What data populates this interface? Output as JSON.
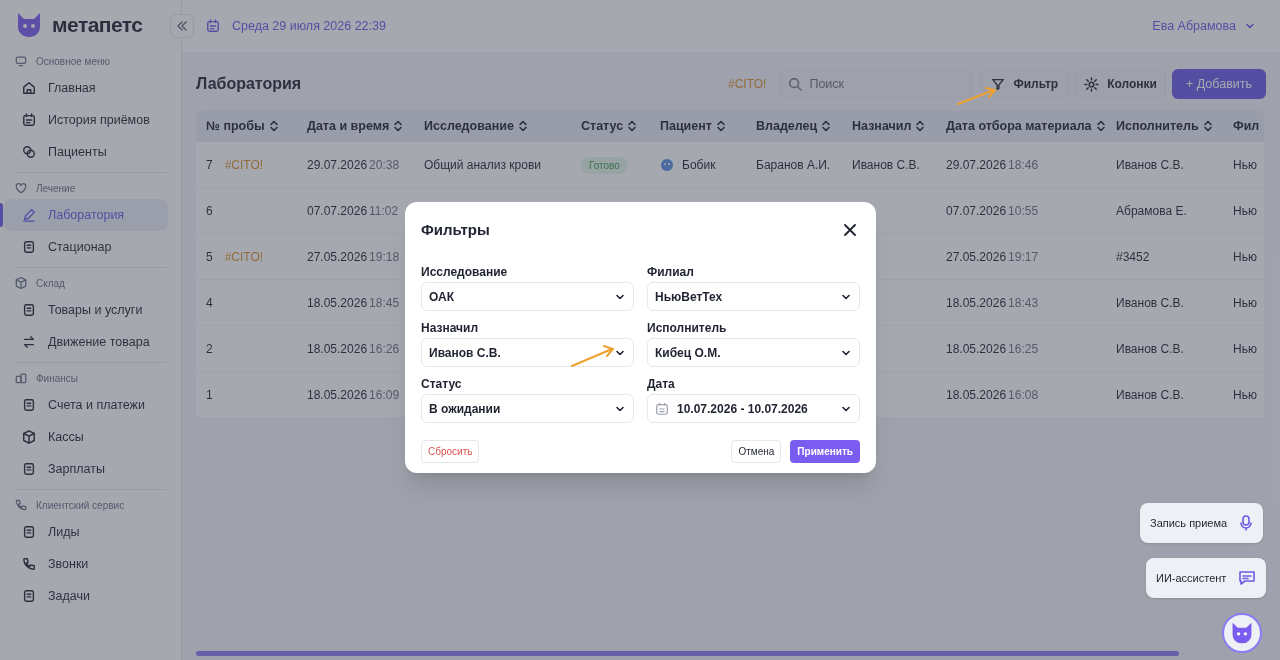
{
  "logo": {
    "text": "метапетс"
  },
  "header": {
    "date": "Среда 29 июля 2026 22:39",
    "user": "Ева Абрамова"
  },
  "sidebar": {
    "sections": [
      {
        "title": "Основное меню",
        "items": [
          {
            "label": "Главная",
            "selected": false
          },
          {
            "label": "История приёмов",
            "selected": false
          },
          {
            "label": "Пациенты",
            "selected": false
          }
        ]
      },
      {
        "title": "Лечение",
        "items": [
          {
            "label": "Лаборатория",
            "selected": true
          },
          {
            "label": "Стационар",
            "selected": false
          }
        ]
      },
      {
        "title": "Склад",
        "items": [
          {
            "label": "Товары и услуги",
            "selected": false
          },
          {
            "label": "Движение товара",
            "selected": false
          }
        ]
      },
      {
        "title": "Финансы",
        "items": [
          {
            "label": "Счета и платежи",
            "selected": false
          },
          {
            "label": "Кассы",
            "selected": false
          },
          {
            "label": "Зарплаты",
            "selected": false
          }
        ]
      },
      {
        "title": "Клиентский сервис",
        "items": [
          {
            "label": "Лиды",
            "selected": false
          },
          {
            "label": "Звонки",
            "selected": false
          },
          {
            "label": "Задачи",
            "selected": false
          }
        ]
      }
    ]
  },
  "page": {
    "title": "Лаборатория",
    "cito_tag": "#CITO!",
    "search": {
      "placeholder": "Поиск"
    },
    "filter_button": "Фильтр",
    "columns_button": "Колонки",
    "add_button": "+ Добавить"
  },
  "table": {
    "columns": [
      "№ пробы",
      "Дата и время",
      "Исследование",
      "Статус",
      "Пациент",
      "Владелец",
      "Назначил",
      "Дата отбора материала",
      "Исполнитель",
      "Фил"
    ],
    "rows": [
      {
        "number": "7",
        "cito": "#CITO!",
        "date": "29.07.2026",
        "time": "20:38",
        "study": "Общий анализ крови",
        "status": "Готово",
        "patient": "Бобик",
        "owner": "Баранов А.И.",
        "assigned": "Иванов С.В.",
        "sample_date": "29.07.2026",
        "sample_time": "18:46",
        "executor": "Иванов С.В.",
        "branch": "Нью"
      },
      {
        "number": "6",
        "date": "07.07.2026",
        "time": "11:02",
        "sample_date": "07.07.2026",
        "sample_time": "10:55",
        "executor": "Абрамова Е.",
        "branch": "Нью"
      },
      {
        "number": "5",
        "cito": "#CITO!",
        "date": "27.05.2026",
        "time": "19:18",
        "sample_date": "27.05.2026",
        "sample_time": "19:17",
        "executor": "#3452",
        "branch": "Нью"
      },
      {
        "number": "4",
        "date": "18.05.2026",
        "time": "18:45",
        "sample_date": "18.05.2026",
        "sample_time": "18:43",
        "executor": "Иванов С.В.",
        "branch": "Нью"
      },
      {
        "number": "2",
        "date": "18.05.2026",
        "time": "16:26",
        "sample_date": "18.05.2026",
        "sample_time": "16:25",
        "executor": "Иванов С.В.",
        "branch": "Нью"
      },
      {
        "number": "1",
        "date": "18.05.2026",
        "time": "16:09",
        "sample_date": "18.05.2026",
        "sample_time": "16:08",
        "executor": "Иванов С.В.",
        "branch": "Нью"
      }
    ]
  },
  "modal": {
    "title": "Фильтры",
    "fields": [
      {
        "label": "Исследование",
        "value": "ОАК",
        "kind": "select"
      },
      {
        "label": "Филиал",
        "value": "НьюВетТех",
        "kind": "select"
      },
      {
        "label": "Назначил",
        "value": "Иванов С.В.",
        "kind": "select"
      },
      {
        "label": "Исполнитель",
        "value": "Кибец О.М.",
        "kind": "select"
      },
      {
        "label": "Статус",
        "value": "В ожидании",
        "kind": "select"
      },
      {
        "label": "Дата",
        "value": "10.07.2026 - 10.07.2026",
        "kind": "date"
      }
    ],
    "reset_button": "Сбросить",
    "cancel_button": "Отмена",
    "apply_button": "Применить"
  },
  "floating": {
    "record_button": "Запись приема",
    "assistant_button": "ИИ-ассистент"
  }
}
